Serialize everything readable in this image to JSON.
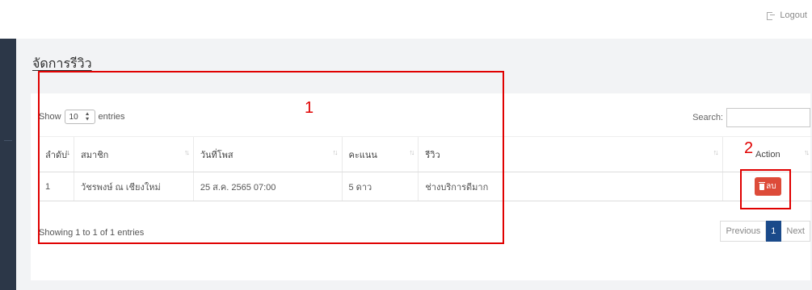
{
  "header": {
    "logout_label": "Logout"
  },
  "page": {
    "title": "จัดการรีวิว"
  },
  "table_controls": {
    "show_label": "Show",
    "page_length": "10",
    "entries_label": "entries",
    "search_label": "Search:"
  },
  "table": {
    "columns": [
      "ลำดับ",
      "สมาชิก",
      "วันที่โพส",
      "คะแนน",
      "รีวิว",
      "Action"
    ],
    "rows": [
      {
        "no": "1",
        "member": "วัชรพงษ์ ณ เชียงใหม่",
        "date": "25 ส.ค. 2565 07:00",
        "score": "5 ดาว",
        "review": "ช่างบริการดีมาก",
        "delete_label": "ลบ"
      }
    ]
  },
  "footer": {
    "info": "Showing 1 to 1 of 1 entries",
    "prev_label": "Previous",
    "current_page": "1",
    "next_label": "Next"
  },
  "annotations": {
    "label_1": "1",
    "label_2": "2"
  },
  "colors": {
    "sidebar": "#2c3748",
    "delete": "#dd4b39",
    "page_active": "#1a4a8a",
    "annotation": "#e00000"
  }
}
